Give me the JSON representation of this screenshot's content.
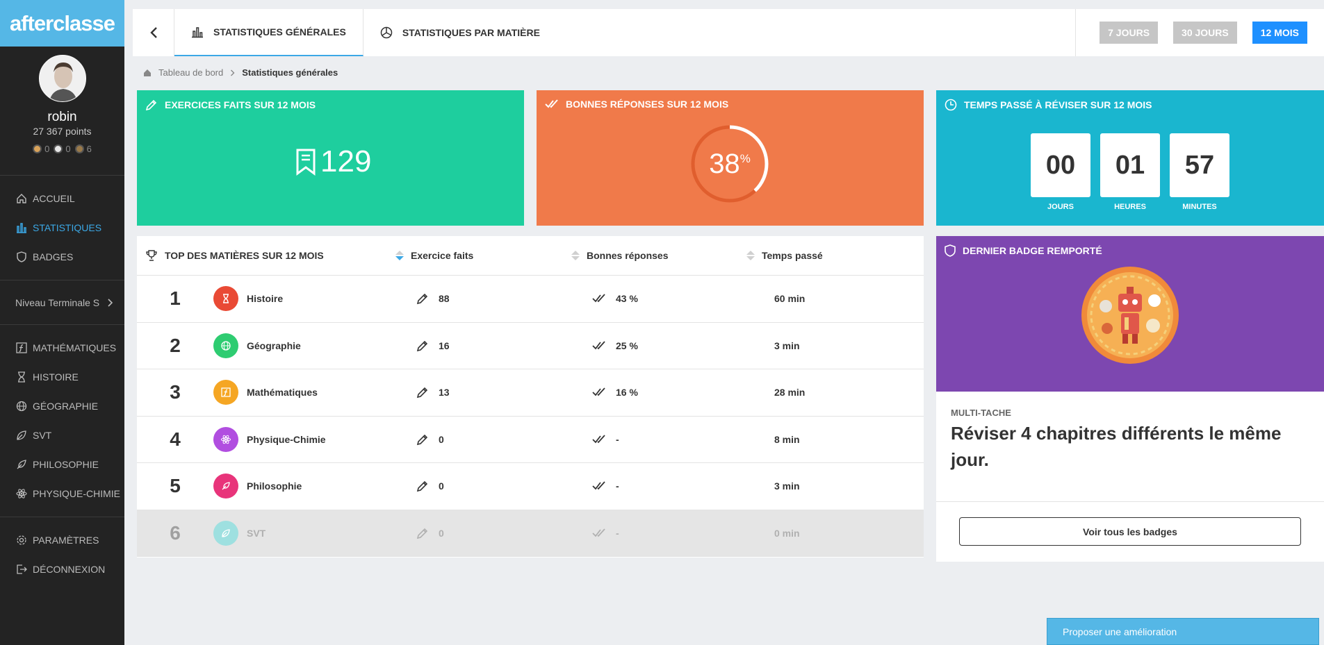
{
  "app": {
    "logo": "afterclasse"
  },
  "user": {
    "name": "robin",
    "points": "27 367 points",
    "medals": [
      {
        "color": "#d9a35a",
        "count": "0"
      },
      {
        "color": "#e6e6e6",
        "count": "0"
      },
      {
        "color": "#9a7a4a",
        "count": "6"
      }
    ]
  },
  "sidebar": {
    "main": [
      {
        "label": "Accueil",
        "icon": "home-icon",
        "active": false
      },
      {
        "label": "Statistiques",
        "icon": "chart-icon",
        "active": true
      },
      {
        "label": "Badges",
        "icon": "shield-icon",
        "active": false
      }
    ],
    "level": "Niveau Terminale S",
    "subjects": [
      {
        "label": "Mathématiques",
        "icon": "function-icon"
      },
      {
        "label": "Histoire",
        "icon": "hourglass-icon"
      },
      {
        "label": "Géographie",
        "icon": "globe-icon"
      },
      {
        "label": "SVT",
        "icon": "leaf-icon"
      },
      {
        "label": "Philosophie",
        "icon": "feather-icon"
      },
      {
        "label": "Physique-Chimie",
        "icon": "atom-icon"
      }
    ],
    "account": [
      {
        "label": "Paramètres",
        "icon": "gear-icon"
      },
      {
        "label": "Déconnexion",
        "icon": "logout-icon"
      }
    ]
  },
  "topbar": {
    "tabs": [
      {
        "label": "STATISTIQUES GÉNÉRALES",
        "active": true
      },
      {
        "label": "STATISTIQUES PAR MATIÈRE",
        "active": false
      }
    ],
    "periods": [
      {
        "label": "7 JOURS",
        "active": false
      },
      {
        "label": "30 JOURS",
        "active": false
      },
      {
        "label": "12 MOIS",
        "active": true
      }
    ]
  },
  "breadcrumb": {
    "root": "Tableau de bord",
    "current": "Statistiques générales"
  },
  "cards": {
    "exercises": {
      "title": "Exercices faits sur 12 mois",
      "value": "129",
      "color": "#1ece9e"
    },
    "correct": {
      "title": "Bonnes réponses sur 12 mois",
      "value": "38",
      "unit": "%",
      "percent": 38,
      "color": "#f07a4a"
    },
    "time": {
      "title": "Temps passé à réviser sur 12 mois",
      "color": "#1ab6cf",
      "units": [
        {
          "value": "00",
          "label": "Jours"
        },
        {
          "value": "01",
          "label": "Heures"
        },
        {
          "value": "57",
          "label": "Minutes"
        }
      ]
    }
  },
  "table": {
    "title": "TOP DES MATIÈRES SUR 12 MOIS",
    "columns": [
      "Exercice faits",
      "Bonnes réponses",
      "Temps passé"
    ],
    "rows": [
      {
        "rank": "1",
        "subject": "Histoire",
        "color": "#e94a35",
        "icon": "hourglass-icon",
        "exercises": "88",
        "correct": "43 %",
        "time": "60 min"
      },
      {
        "rank": "2",
        "subject": "Géographie",
        "color": "#2ecc71",
        "icon": "globe-icon",
        "exercises": "16",
        "correct": "25 %",
        "time": "3 min"
      },
      {
        "rank": "3",
        "subject": "Mathématiques",
        "color": "#f5a623",
        "icon": "function-icon",
        "exercises": "13",
        "correct": "16 %",
        "time": "28 min"
      },
      {
        "rank": "4",
        "subject": "Physique-Chimie",
        "color": "#b14ee0",
        "icon": "atom-icon",
        "exercises": "0",
        "correct": "-",
        "time": "8 min"
      },
      {
        "rank": "5",
        "subject": "Philosophie",
        "color": "#e8347a",
        "icon": "feather-icon",
        "exercises": "0",
        "correct": "-",
        "time": "3 min"
      },
      {
        "rank": "6",
        "subject": "SVT",
        "color": "#9ee0e0",
        "icon": "leaf-icon",
        "exercises": "0",
        "correct": "-",
        "time": "0 min"
      }
    ]
  },
  "badge": {
    "title": "DERNIER BADGE REMPORTÉ",
    "category": "MULTI-TACHE",
    "text": "Réviser 4 chapitres différents le même jour.",
    "button": "Voir tous les badges",
    "color": "#7d47b0"
  },
  "feedback": {
    "label": "Proposer une amélioration"
  }
}
